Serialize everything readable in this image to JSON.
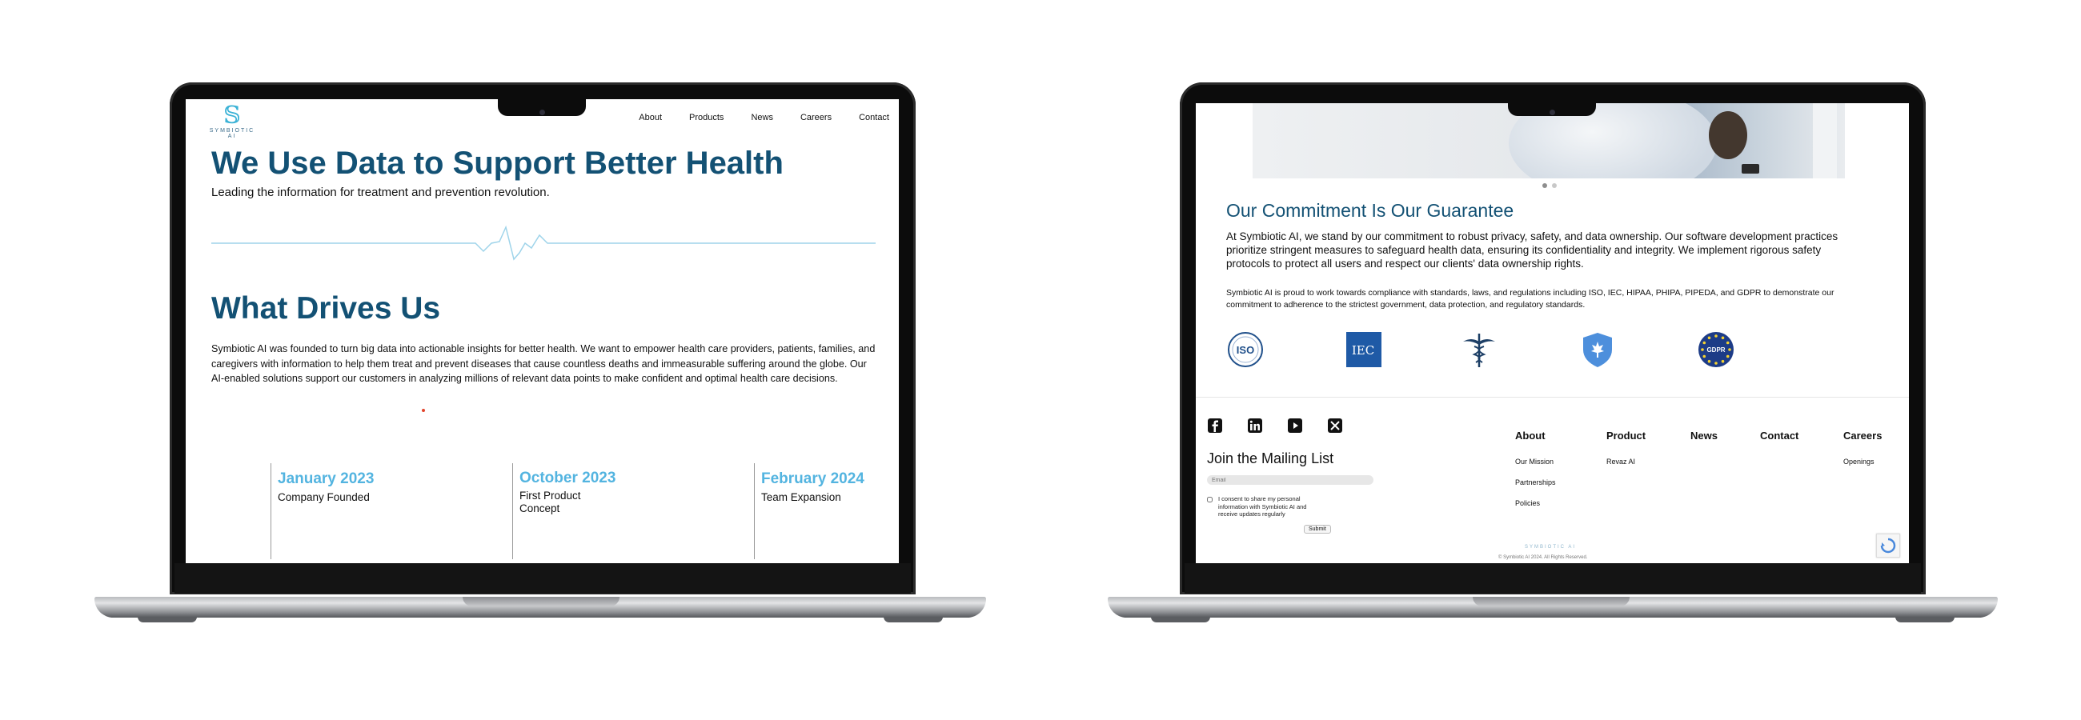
{
  "left_page": {
    "logo_text": "SYMBIOTIC AI",
    "nav": [
      "About",
      "Products",
      "News",
      "Careers",
      "Contact"
    ],
    "hero_title": "We Use Data to Support Better Health",
    "hero_subtitle": "Leading the information for treatment and prevention revolution.",
    "section_title": "What Drives Us",
    "section_body": "Symbiotic AI was founded to turn big data into actionable insights for better health. We want to empower health care providers, patients, families, and caregivers with information to help them treat and prevent diseases that cause countless deaths and immeasurable suffering around the globe. Our AI-enabled solutions support our customers in analyzing millions of relevant data points to make confident and optimal health care decisions.",
    "timeline": [
      {
        "date": "January 2023",
        "text": "Company Founded"
      },
      {
        "date": "October 2023",
        "text": "First Product Concept"
      },
      {
        "date": "February 2024",
        "text": "Team Expansion"
      }
    ]
  },
  "right_page": {
    "commitment_title": "Our Commitment Is Our Guarantee",
    "commitment_p1": "At Symbiotic AI, we stand by our commitment to robust privacy, safety, and data ownership. Our software development practices prioritize stringent measures to safeguard health data, ensuring its confidentiality and integrity. We implement rigorous safety protocols to protect all users and respect our clients' data ownership rights.",
    "commitment_p2": "Symbiotic AI is proud to work towards compliance with standards, laws, and regulations including ISO, IEC, HIPAA, PHIPA, PIPEDA, and GDPR to demonstrate our commitment to adherence to the strictest government, data protection, and regulatory standards.",
    "badges": [
      "ISO",
      "IEC",
      "GDPR"
    ],
    "social": [
      "facebook-icon",
      "linkedin-icon",
      "youtube-icon",
      "x-icon"
    ],
    "mailing": {
      "title": "Join the Mailing List",
      "email_placeholder": "Email",
      "consent": "I consent to share my personal information with Symbiotic AI and receive updates regularly",
      "submit": "Submit"
    },
    "footer_columns": [
      {
        "title": "About",
        "links": [
          "Our Mission",
          "Partnerships",
          "Policies"
        ]
      },
      {
        "title": "Product",
        "links": [
          "Revaz AI"
        ]
      },
      {
        "title": "News",
        "links": []
      },
      {
        "title": "Contact",
        "links": []
      },
      {
        "title": "Careers",
        "links": [
          "Openings"
        ]
      }
    ],
    "footer_logo": "SYMBIOTIC AI",
    "copyright": "© Symbiotic AI 2024. All Rights Reserved."
  },
  "colors": {
    "heading": "#135174",
    "accent": "#53b4e0",
    "ecg": "#9fd4ea"
  }
}
